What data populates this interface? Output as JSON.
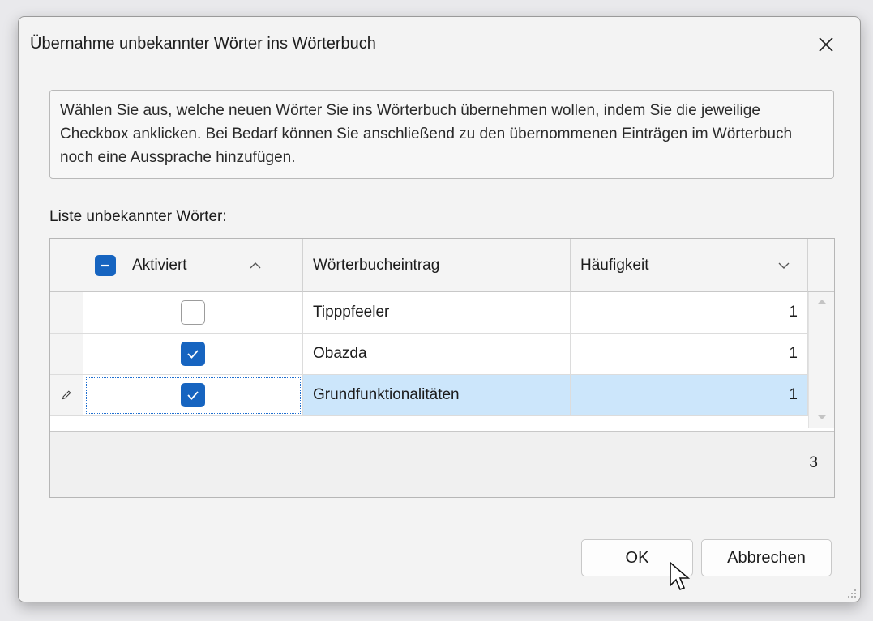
{
  "dialog": {
    "title": "Übernahme unbekannter Wörter ins Wörterbuch",
    "info_text": "Wählen Sie aus, welche neuen Wörter Sie ins Wörterbuch übernehmen wollen, indem Sie die jeweilige Checkbox anklicken. Bei Bedarf können Sie anschließend zu den übernommenen Einträgen im Wörterbuch noch eine Aussprache hinzufügen.",
    "list_label": "Liste unbekannter Wörter:",
    "ok_label": "OK",
    "cancel_label": "Abbrechen"
  },
  "grid": {
    "columns": [
      "Aktiviert",
      "Wörterbucheintrag",
      "Häufigkeit"
    ],
    "rows": [
      {
        "active": false,
        "entry": "Tipppfeeler",
        "frequency": "1"
      },
      {
        "active": true,
        "entry": "Obazda",
        "frequency": "1"
      },
      {
        "active": true,
        "entry": "Grundfunktionalitäten",
        "frequency": "1"
      }
    ],
    "total": "3"
  },
  "colors": {
    "accent": "#1664c0",
    "selected_row": "#cce6fb"
  },
  "icons": {
    "close": "close-icon",
    "sort_asc": "chevron-up-icon",
    "dropdown": "chevron-down-icon",
    "edit_row": "pencil-icon",
    "cursor": "mouse-pointer-icon"
  }
}
